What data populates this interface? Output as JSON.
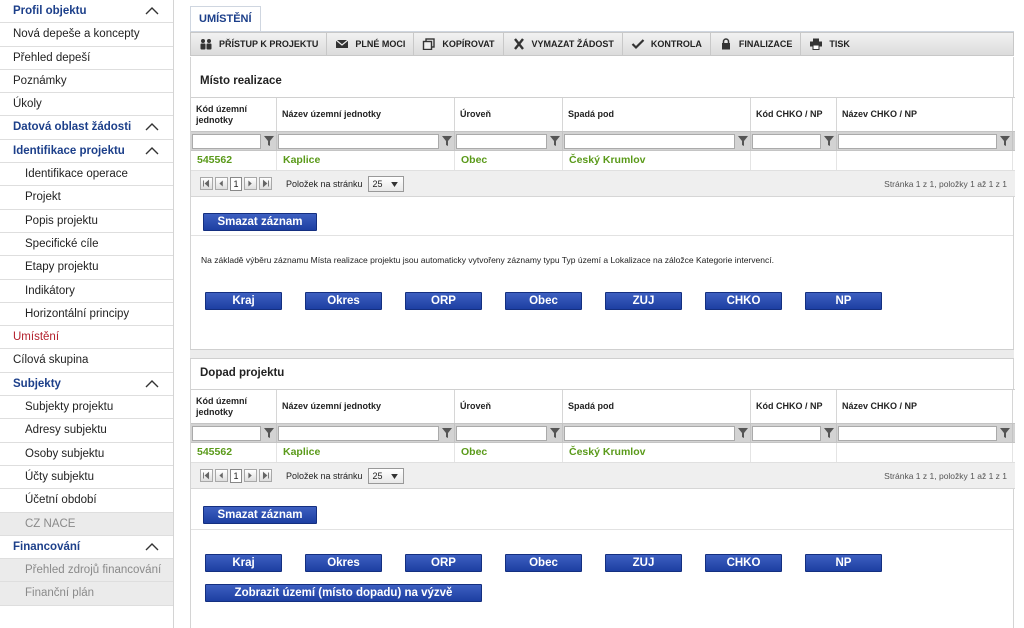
{
  "sidebar": {
    "items": [
      {
        "label": "Profil objektu",
        "type": "section",
        "chevron": true
      },
      {
        "label": "Nová depeše a koncepty",
        "type": "item"
      },
      {
        "label": "Přehled depeší",
        "type": "item"
      },
      {
        "label": "Poznámky",
        "type": "item"
      },
      {
        "label": "Úkoly",
        "type": "item"
      },
      {
        "label": "Datová oblast žádosti",
        "type": "section",
        "chevron": true
      },
      {
        "label": "Identifikace projektu",
        "type": "section-sub",
        "chevron": true
      },
      {
        "label": "Identifikace operace",
        "type": "sub"
      },
      {
        "label": "Projekt",
        "type": "sub"
      },
      {
        "label": "Popis projektu",
        "type": "sub"
      },
      {
        "label": "Specifické cíle",
        "type": "sub"
      },
      {
        "label": "Etapy projektu",
        "type": "sub"
      },
      {
        "label": "Indikátory",
        "type": "sub"
      },
      {
        "label": "Horizontální principy",
        "type": "sub"
      },
      {
        "label": "Umístění",
        "type": "active"
      },
      {
        "label": "Cílová skupina",
        "type": "item"
      },
      {
        "label": "Subjekty",
        "type": "section-sub",
        "chevron": true
      },
      {
        "label": "Subjekty projektu",
        "type": "sub"
      },
      {
        "label": "Adresy subjektu",
        "type": "sub"
      },
      {
        "label": "Osoby subjektu",
        "type": "sub"
      },
      {
        "label": "Účty subjektu",
        "type": "sub"
      },
      {
        "label": "Účetní období",
        "type": "sub"
      },
      {
        "label": "CZ NACE",
        "type": "disabled"
      },
      {
        "label": "Financování",
        "type": "section-sub",
        "chevron": true
      },
      {
        "label": "Přehled zdrojů financování",
        "type": "disabled"
      },
      {
        "label": "Finanční plán",
        "type": "disabled"
      }
    ]
  },
  "tab": {
    "label": "UMÍSTĚNÍ"
  },
  "toolbar": {
    "buttons": [
      {
        "label": "PŘÍSTUP K PROJEKTU",
        "icon": "people-icon"
      },
      {
        "label": "PLNÉ MOCI",
        "icon": "envelope-icon"
      },
      {
        "label": "KOPÍROVAT",
        "icon": "copy-icon"
      },
      {
        "label": "VYMAZAT ŽÁDOST",
        "icon": "x-icon"
      },
      {
        "label": "KONTROLA",
        "icon": "check-icon"
      },
      {
        "label": "FINALIZACE",
        "icon": "lock-icon"
      },
      {
        "label": "TISK",
        "icon": "printer-icon"
      }
    ]
  },
  "misto": {
    "title": "Místo realizace",
    "headers": [
      "Kód územní jednotky",
      "Název územní jednotky",
      "Úroveň",
      "Spadá pod",
      "Kód CHKO / NP",
      "Název CHKO / NP"
    ],
    "row": [
      "545562",
      "Kaplice",
      "Obec",
      "Český Krumlov",
      "",
      ""
    ],
    "pager": {
      "page": "1",
      "per_page_label": "Položek na stránku",
      "per_page": "25",
      "info": "Stránka 1 z 1, položky 1 až 1 z 1"
    },
    "delete_label": "Smazat záznam",
    "note": "Na základě výběru záznamu Místa realizace projektu jsou automaticky vytvořeny záznamy typu Typ území a Lokalizace na záložce Kategorie intervencí.",
    "buttons": [
      "Kraj",
      "Okres",
      "ORP",
      "Obec",
      "ZUJ",
      "CHKO",
      "NP"
    ]
  },
  "dopad": {
    "title": "Dopad projektu",
    "headers": [
      "Kód územní jednotky",
      "Název územní jednotky",
      "Úroveň",
      "Spadá pod",
      "Kód CHKO / NP",
      "Název CHKO / NP"
    ],
    "row": [
      "545562",
      "Kaplice",
      "Obec",
      "Český Krumlov",
      "",
      ""
    ],
    "pager": {
      "page": "1",
      "per_page_label": "Položek na stránku",
      "per_page": "25",
      "info": "Stránka 1 z 1, položky 1 až 1 z 1"
    },
    "delete_label": "Smazat záznam",
    "buttons": [
      "Kraj",
      "Okres",
      "ORP",
      "Obec",
      "ZUJ",
      "CHKO",
      "NP"
    ],
    "show_label": "Zobrazit území (místo dopadu) na výzvě"
  }
}
